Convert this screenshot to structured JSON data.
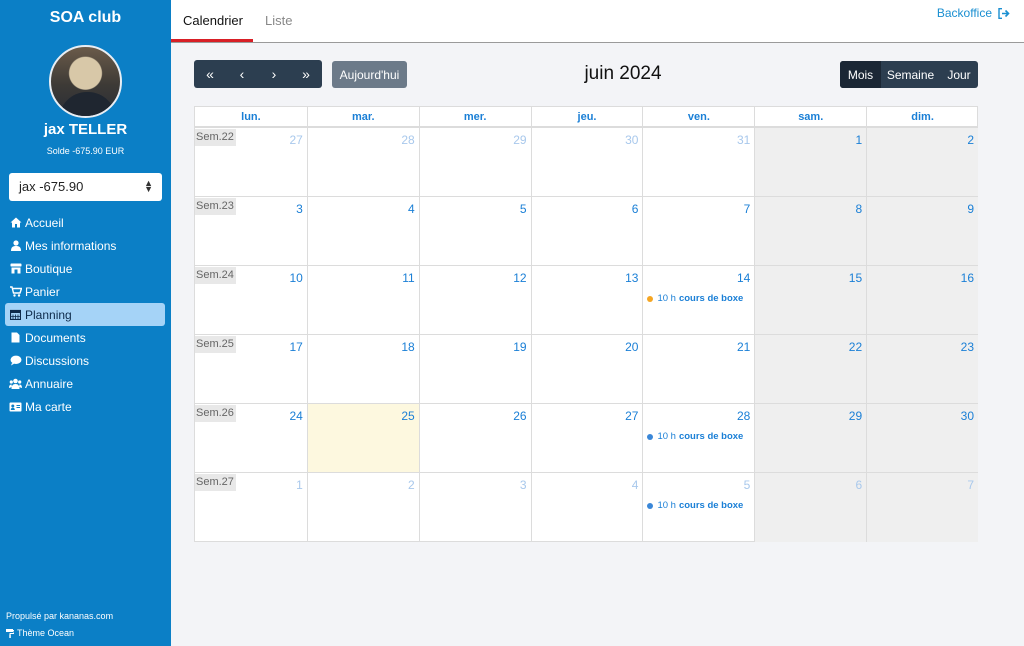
{
  "sidebar": {
    "club_name": "SOA club",
    "user_name": "jax TELLER",
    "solde": "Solde  -675.90 EUR",
    "account_select": "jax -675.90",
    "nav": [
      {
        "label": "Accueil",
        "icon": "home-icon"
      },
      {
        "label": "Mes informations",
        "icon": "user-icon"
      },
      {
        "label": "Boutique",
        "icon": "store-icon"
      },
      {
        "label": "Panier",
        "icon": "cart-icon"
      },
      {
        "label": "Planning",
        "icon": "calendar-icon",
        "active": true
      },
      {
        "label": "Documents",
        "icon": "file-icon"
      },
      {
        "label": "Discussions",
        "icon": "comment-icon"
      },
      {
        "label": "Annuaire",
        "icon": "users-icon"
      },
      {
        "label": "Ma carte",
        "icon": "id-card-icon"
      }
    ],
    "footer_powered": "Propulsé par kananas.com",
    "footer_theme": "Thème Ocean"
  },
  "tabs": {
    "calendar": "Calendrier",
    "list": "Liste",
    "backoffice": "Backoffice"
  },
  "toolbar": {
    "prev_year": "«",
    "prev": "‹",
    "next": "›",
    "next_year": "»",
    "today": "Aujourd'hui",
    "title": "juin 2024",
    "view_month": "Mois",
    "view_week": "Semaine",
    "view_day": "Jour"
  },
  "calendar": {
    "weekdays": [
      "lun.",
      "mar.",
      "mer.",
      "jeu.",
      "ven.",
      "sam.",
      "dim."
    ],
    "weeks": [
      {
        "label": "Sem.22",
        "days": [
          {
            "n": "27",
            "other": true
          },
          {
            "n": "28",
            "other": true
          },
          {
            "n": "29",
            "other": true
          },
          {
            "n": "30",
            "other": true
          },
          {
            "n": "31",
            "other": true
          },
          {
            "n": "1"
          },
          {
            "n": "2"
          }
        ]
      },
      {
        "label": "Sem.23",
        "days": [
          {
            "n": "3"
          },
          {
            "n": "4"
          },
          {
            "n": "5"
          },
          {
            "n": "6"
          },
          {
            "n": "7"
          },
          {
            "n": "8"
          },
          {
            "n": "9"
          }
        ]
      },
      {
        "label": "Sem.24",
        "days": [
          {
            "n": "10"
          },
          {
            "n": "11"
          },
          {
            "n": "12"
          },
          {
            "n": "13"
          },
          {
            "n": "14",
            "event": {
              "time": "10 h",
              "title": "cours de boxe",
              "color": "#f5a623"
            }
          },
          {
            "n": "15"
          },
          {
            "n": "16"
          }
        ]
      },
      {
        "label": "Sem.25",
        "days": [
          {
            "n": "17"
          },
          {
            "n": "18"
          },
          {
            "n": "19"
          },
          {
            "n": "20"
          },
          {
            "n": "21"
          },
          {
            "n": "22"
          },
          {
            "n": "23"
          }
        ]
      },
      {
        "label": "Sem.26",
        "days": [
          {
            "n": "24"
          },
          {
            "n": "25",
            "today": true
          },
          {
            "n": "26"
          },
          {
            "n": "27"
          },
          {
            "n": "28",
            "event": {
              "time": "10 h",
              "title": "cours de boxe",
              "color": "#3a87d8"
            }
          },
          {
            "n": "29"
          },
          {
            "n": "30"
          }
        ]
      },
      {
        "label": "Sem.27",
        "days": [
          {
            "n": "1",
            "other": true
          },
          {
            "n": "2",
            "other": true
          },
          {
            "n": "3",
            "other": true
          },
          {
            "n": "4",
            "other": true
          },
          {
            "n": "5",
            "other": true,
            "event": {
              "time": "10 h",
              "title": "cours de boxe",
              "color": "#3a87d8"
            }
          },
          {
            "n": "6",
            "other": true
          },
          {
            "n": "7",
            "other": true
          }
        ]
      }
    ]
  },
  "colors": {
    "sidebar_bg": "#0b7fc6",
    "accent_blue": "#1a7fd6",
    "active_tab_underline": "#d81f26",
    "nav_active_bg": "#a5d3f7"
  }
}
